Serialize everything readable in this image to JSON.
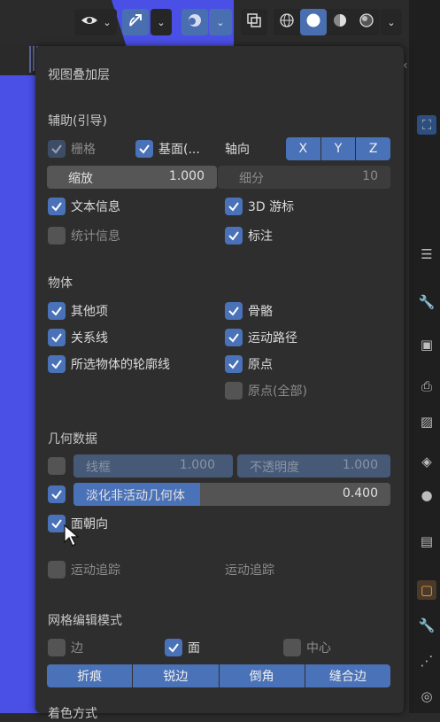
{
  "header": {
    "overlay_dropdown_chevron": "chevron-down",
    "shading_modes": [
      "wireframe",
      "solid",
      "material",
      "rendered"
    ]
  },
  "popover": {
    "title": "视图叠加层",
    "guides": {
      "heading": "辅助(引导)",
      "grid": {
        "label": "栅格",
        "checked": true
      },
      "floor": {
        "label": "基面(...",
        "checked": true
      },
      "axes_label": "轴向",
      "axes": [
        "X",
        "Y",
        "Z"
      ],
      "scale": {
        "label": "缩放",
        "value": "1.000"
      },
      "subdivisions": {
        "label": "细分",
        "value": "10"
      },
      "text_info": {
        "label": "文本信息",
        "checked": true
      },
      "cursor_3d": {
        "label": "3D 游标",
        "checked": true
      },
      "statistics": {
        "label": "统计信息",
        "checked": false
      },
      "annotations": {
        "label": "标注",
        "checked": true
      }
    },
    "objects": {
      "heading": "物体",
      "extras": {
        "label": "其他项",
        "checked": true
      },
      "bones": {
        "label": "骨骼",
        "checked": true
      },
      "relationship_lines": {
        "label": "关系线",
        "checked": true
      },
      "motion_paths": {
        "label": "运动路径",
        "checked": true
      },
      "outline_selected": {
        "label": "所选物体的轮廓线",
        "checked": true
      },
      "origins": {
        "label": "原点",
        "checked": true
      },
      "origins_all": {
        "label": "原点(全部)",
        "checked": false
      }
    },
    "geometry": {
      "heading": "几何数据",
      "wireframe": {
        "label": "线框",
        "value": "1.000",
        "checked": false
      },
      "opacity": {
        "label": "不透明度",
        "value": "1.000"
      },
      "fade_inactive": {
        "label": "淡化非活动几何体",
        "value": "0.400",
        "checked": true,
        "fraction": 0.4
      },
      "face_orientation": {
        "label": "面朝向",
        "checked": true
      }
    },
    "motion_tracking": {
      "label": "运动追踪",
      "checked": false,
      "side_label": "运动追踪"
    },
    "mesh_edit": {
      "heading": "网格编辑模式",
      "edges": {
        "label": "边",
        "checked": false
      },
      "faces": {
        "label": "面",
        "checked": true
      },
      "center": {
        "label": "中心",
        "checked": false
      },
      "buttons": [
        "折痕",
        "锐边",
        "倒角",
        "缝合边"
      ]
    },
    "shading_partial": "着色方式"
  }
}
